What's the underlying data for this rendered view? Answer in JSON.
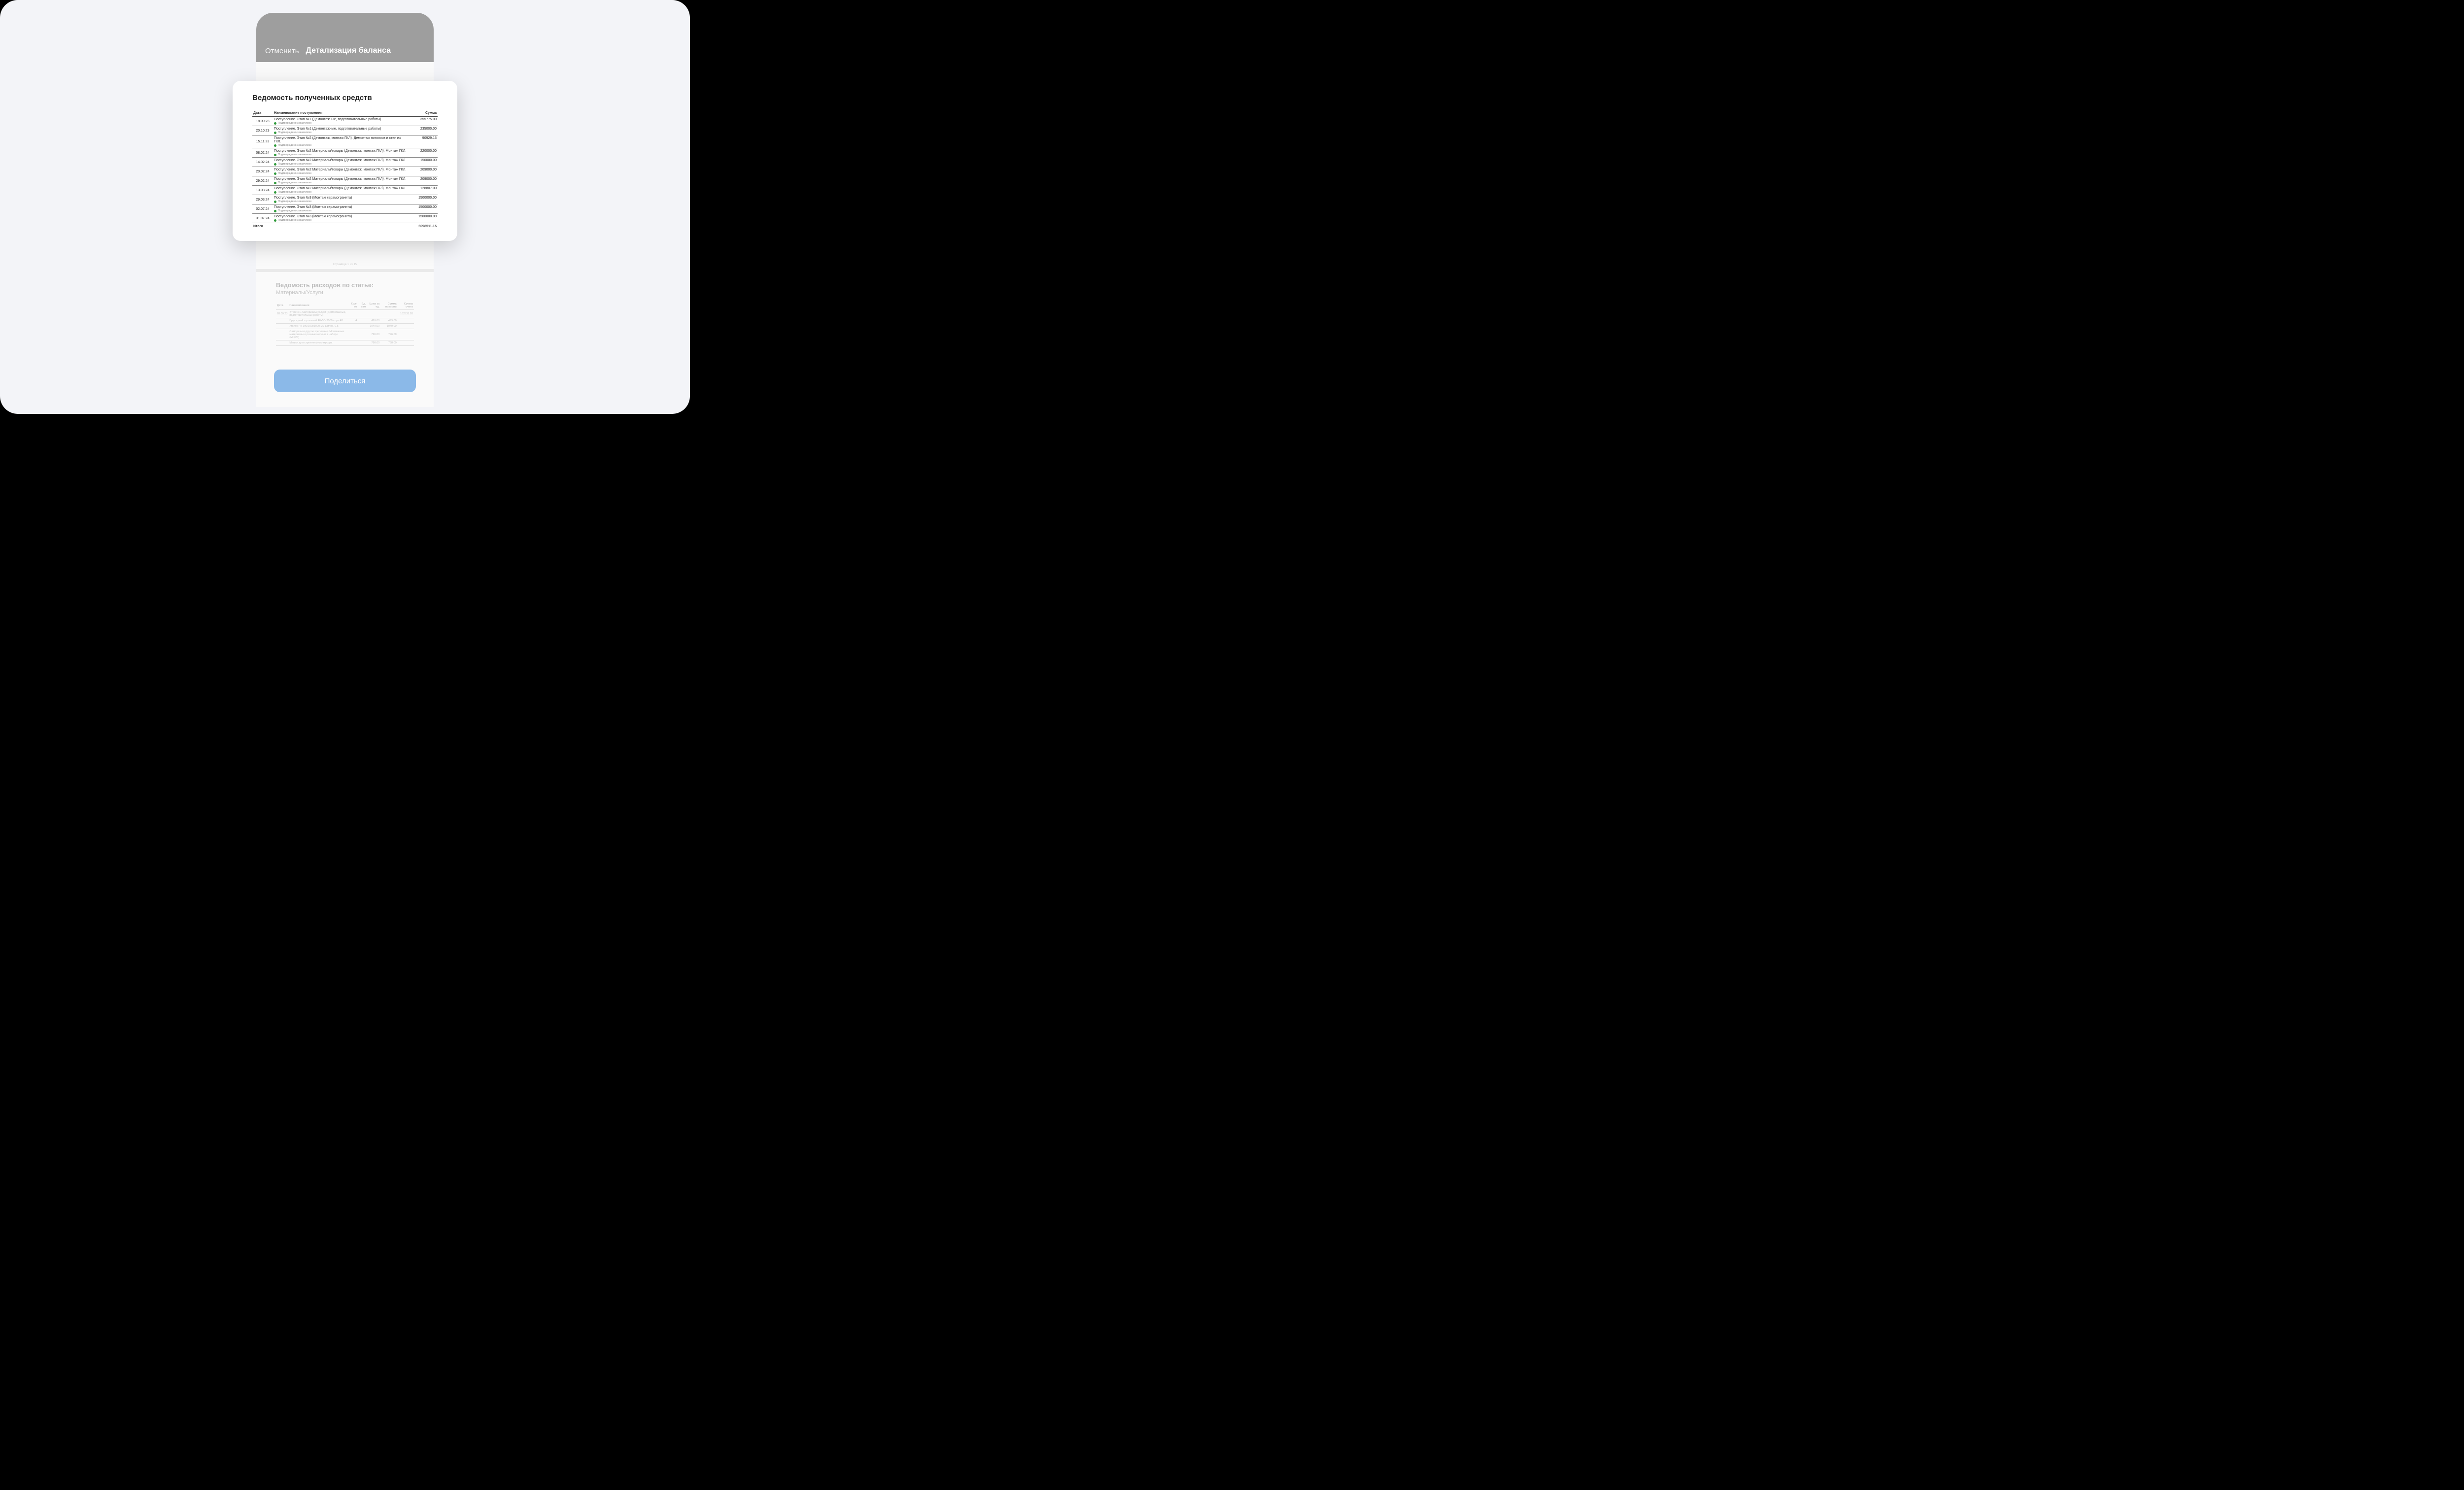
{
  "header": {
    "cancel": "Отменить",
    "title": "Детализация баланса"
  },
  "card": {
    "title": "Ведомость полученных средств",
    "columns": {
      "date": "Дата",
      "name": "Наименование поступления",
      "amount": "Сумма"
    },
    "status_label": "Подтверждено заказчиком",
    "rows": [
      {
        "date": "18.09.23",
        "name": "Поступление. Этап №1 (Демонтажные, подготовительные работы)",
        "amount": "355775.00"
      },
      {
        "date": "20.10.23",
        "name": "Поступление. Этап №1 (Демонтажные, подготовительные работы)",
        "amount": "235000.00"
      },
      {
        "date": "15.11.23",
        "name": "Поступление. Этап №2 (Демонтаж, монтаж ГКЛ). Демонтаж потолков и стен из ГКЛ.",
        "amount": "90929.15"
      },
      {
        "date": "08.02.24",
        "name": "Поступление. Этап №2 Материалы/товары (Демонтаж, монтаж ГКЛ). Монтаж ГКЛ.",
        "amount": "220000.00"
      },
      {
        "date": "14.02.24",
        "name": "Поступление. Этап №2 Материалы/товары (Демонтаж, монтаж ГКЛ). Монтаж ГКЛ.",
        "amount": "150000.00"
      },
      {
        "date": "20.02.24",
        "name": "Поступление. Этап №2 Материалы/товары (Демонтаж, монтаж ГКЛ). Монтаж ГКЛ.",
        "amount": "209000.00"
      },
      {
        "date": "29.02.24",
        "name": "Поступление. Этап №2 Материалы/товары (Демонтаж, монтаж ГКЛ). Монтаж ГКЛ.",
        "amount": "209000.00"
      },
      {
        "date": "13.03.24",
        "name": "Поступление. Этап №2 Материалы/товары (Демонтаж, монтаж ГКЛ). Монтаж ГКЛ.",
        "amount": "128807.00"
      },
      {
        "date": "29.03.24",
        "name": "Поступление. Этап №3 (Монтаж керамогранита)",
        "amount": "1500000.00"
      },
      {
        "date": "02.07.24",
        "name": "Поступление. Этап №3 (Монтаж керамогранита)",
        "amount": "1500000.00"
      },
      {
        "date": "31.07.24",
        "name": "Поступление. Этап №3 (Монтаж керамогранита)",
        "amount": "1500000.00"
      }
    ],
    "total_label": "Итого",
    "total": "6098511.15"
  },
  "page_indicator": "Страница 1 из 15",
  "section2": {
    "title": "Ведомость расходов по статье:",
    "subtitle": "Материалы/Услуги",
    "columns": {
      "date": "Дата",
      "name": "Наименование",
      "qty": "Кол-во",
      "unit": "Ед. изм",
      "price": "Цена за ед.",
      "line": "Сумма позиции",
      "inv": "Сумма счета"
    },
    "rows": [
      {
        "date": "28.09.23",
        "name": "Этап №1. Материалы/Услуги (Демонтажные, подготовительные работы)",
        "qty": "",
        "unit": "",
        "price": "",
        "line": "",
        "inv": "162531.20"
      },
      {
        "date": "",
        "name": "Брус сухой строганый 40х50х3000 сорт АВ",
        "qty": "4",
        "unit": "",
        "price": "499.00",
        "line": "499.00",
        "inv": ""
      },
      {
        "date": "",
        "name": "Уголок РК 100/100х1000 мм шипов. 0.5",
        "qty": "",
        "unit": "",
        "price": "1049.00",
        "line": "1049.00",
        "inv": ""
      },
      {
        "date": "",
        "name": "Саморезы и другое крепление. Монтажные материалы и разные мелочи в наборе (MIX20)",
        "qty": "",
        "unit": "",
        "price": "796.00",
        "line": "796.00",
        "inv": ""
      },
      {
        "date": "",
        "name": "Мешки для строительного мусора",
        "qty": "",
        "unit": "",
        "price": "798.00",
        "line": "798.00",
        "inv": ""
      }
    ]
  },
  "share_button": "Поделиться"
}
